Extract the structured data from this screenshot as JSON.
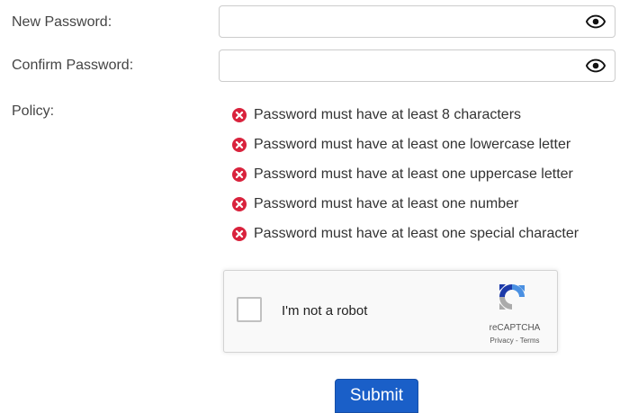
{
  "form": {
    "new_password_label": "New Password:",
    "new_password_value": "",
    "confirm_password_label": "Confirm Password:",
    "confirm_password_value": "",
    "policy_label": "Policy:"
  },
  "policy": {
    "items": [
      {
        "text": "Password must have at least 8 characters",
        "status": "failed"
      },
      {
        "text": "Password must have at least one lowercase letter",
        "status": "failed"
      },
      {
        "text": "Password must have at least one uppercase letter",
        "status": "failed"
      },
      {
        "text": "Password must have at least one number",
        "status": "failed"
      },
      {
        "text": "Password must have at least one special character",
        "status": "failed"
      }
    ],
    "fail_color": "#d9233d"
  },
  "recaptcha": {
    "label": "I'm not a robot",
    "brand": "reCAPTCHA",
    "privacy": "Privacy",
    "separator": " - ",
    "terms": "Terms",
    "checked": false
  },
  "submit": {
    "label": "Submit",
    "color": "#1a5fc8"
  },
  "icons": {
    "show_password": "eye-icon",
    "policy_fail": "x-circle-icon",
    "recaptcha_logo": "recaptcha-logo-icon"
  }
}
